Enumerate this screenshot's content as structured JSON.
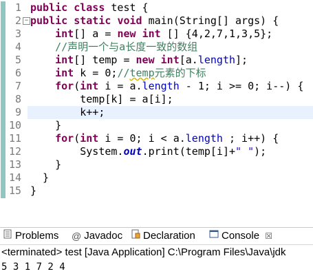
{
  "editor": {
    "lines": [
      {
        "num": "1",
        "tokens": [
          {
            "t": "public",
            "c": "kw"
          },
          {
            "t": " "
          },
          {
            "t": "class",
            "c": "kw"
          },
          {
            "t": " test {"
          }
        ]
      },
      {
        "num": "2",
        "tokens": [
          {
            "t": "public",
            "c": "kw"
          },
          {
            "t": " "
          },
          {
            "t": "static",
            "c": "kw"
          },
          {
            "t": " "
          },
          {
            "t": "void",
            "c": "kw"
          },
          {
            "t": " main(String[] args) {"
          }
        ]
      },
      {
        "num": "3",
        "tokens": [
          {
            "t": "    "
          },
          {
            "t": "int",
            "c": "kw"
          },
          {
            "t": "[] a = "
          },
          {
            "t": "new",
            "c": "kw"
          },
          {
            "t": " "
          },
          {
            "t": "int",
            "c": "kw"
          },
          {
            "t": " [] {4,2,7,1,3,5};"
          }
        ]
      },
      {
        "num": "4",
        "tokens": [
          {
            "t": "    "
          },
          {
            "t": "//声明一个与a长度一致的数组",
            "c": "cm"
          }
        ]
      },
      {
        "num": "5",
        "tokens": [
          {
            "t": "    "
          },
          {
            "t": "int",
            "c": "kw"
          },
          {
            "t": "[] temp = "
          },
          {
            "t": "new",
            "c": "kw"
          },
          {
            "t": " "
          },
          {
            "t": "int",
            "c": "kw"
          },
          {
            "t": "[a."
          },
          {
            "t": "length",
            "c": "fld"
          },
          {
            "t": "];"
          }
        ]
      },
      {
        "num": "6",
        "tokens": [
          {
            "t": "    "
          },
          {
            "t": "int",
            "c": "kw"
          },
          {
            "t": " k = 0;"
          },
          {
            "t": "//",
            "c": "cm"
          },
          {
            "t": "temp",
            "c": "cm squig"
          },
          {
            "t": "元素的下标",
            "c": "cm"
          }
        ]
      },
      {
        "num": "7",
        "tokens": [
          {
            "t": "    "
          },
          {
            "t": "for",
            "c": "kw"
          },
          {
            "t": "("
          },
          {
            "t": "int",
            "c": "kw"
          },
          {
            "t": " i = a."
          },
          {
            "t": "length",
            "c": "fld"
          },
          {
            "t": " - 1; i >= 0; i--) {"
          }
        ]
      },
      {
        "num": "8",
        "tokens": [
          {
            "t": "        temp[k] = a[i];"
          }
        ]
      },
      {
        "num": "9",
        "tokens": [
          {
            "t": "        k++;"
          }
        ]
      },
      {
        "num": "10",
        "tokens": [
          {
            "t": "    }"
          }
        ]
      },
      {
        "num": "11",
        "tokens": [
          {
            "t": "    "
          },
          {
            "t": "for",
            "c": "kw"
          },
          {
            "t": "("
          },
          {
            "t": "int",
            "c": "kw"
          },
          {
            "t": " i = 0; i < a."
          },
          {
            "t": "length",
            "c": "fld"
          },
          {
            "t": " ; i++) {"
          }
        ]
      },
      {
        "num": "12",
        "tokens": [
          {
            "t": "        System."
          },
          {
            "t": "out",
            "c": "sfld"
          },
          {
            "t": ".print(temp[i]+"
          },
          {
            "t": "\" \"",
            "c": "str"
          },
          {
            "t": ");"
          }
        ]
      },
      {
        "num": "13",
        "tokens": [
          {
            "t": "    }"
          }
        ]
      },
      {
        "num": "14",
        "tokens": [
          {
            "t": "  }"
          }
        ]
      },
      {
        "num": "15",
        "tokens": [
          {
            "t": "}"
          }
        ]
      }
    ],
    "current_line": 9,
    "fold_minus_lines": [
      2
    ]
  },
  "tabs": [
    {
      "label": "Problems",
      "icon": "problems-icon",
      "active": false
    },
    {
      "label": "Javadoc",
      "icon": "javadoc-icon",
      "active": false
    },
    {
      "label": "Declaration",
      "icon": "declaration-icon",
      "active": false
    },
    {
      "label": "Console",
      "icon": "console-icon",
      "active": true,
      "close": "☒"
    }
  ],
  "console": {
    "status": "<terminated> test [Java Application] C:\\Program Files\\Java\\jdk",
    "output": "5 3 1 7 2 4"
  },
  "colors": {
    "keyword": "#7f0055",
    "comment": "#3f7f5f",
    "string": "#2a00ff",
    "field": "#0000c0",
    "current_line": "#e8f2fe"
  }
}
